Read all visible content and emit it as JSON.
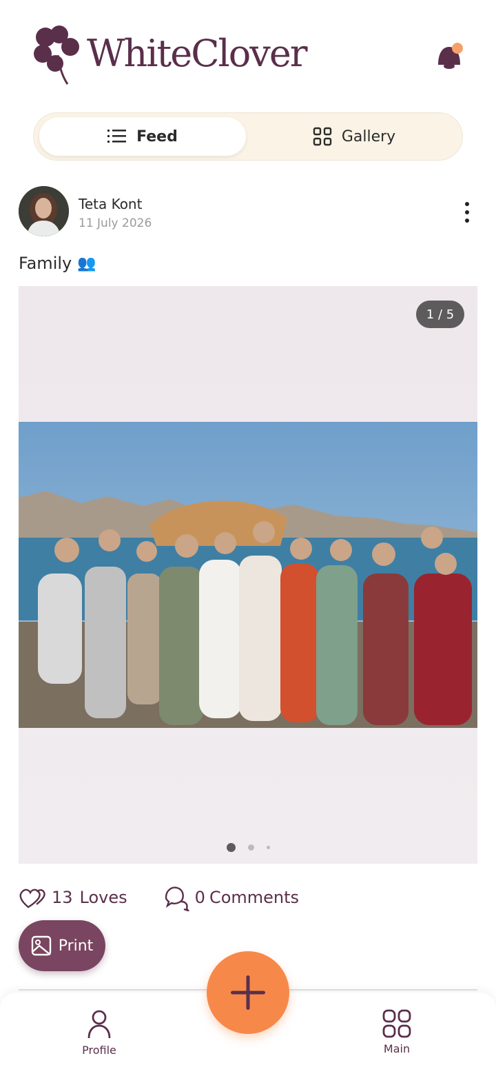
{
  "app": {
    "logo_text": "WhiteClover"
  },
  "tabs": {
    "feed_label": "Feed",
    "gallery_label": "Gallery"
  },
  "post": {
    "author": "Teta Kont",
    "date": "11 July 2026",
    "caption": "Family",
    "caption_emoji": "👥",
    "image_counter": "1 / 5",
    "loves_count": "13",
    "loves_label": "Loves",
    "comments_count": "0",
    "comments_label": "Comments"
  },
  "actions": {
    "print_label": "Print"
  },
  "bottom_nav": {
    "profile_label": "Profile",
    "main_label": "Main"
  },
  "colors": {
    "brand": "#5a2f4a",
    "accent": "#f6894a",
    "print": "#7a4561",
    "segment_bg": "#faf3e6"
  }
}
